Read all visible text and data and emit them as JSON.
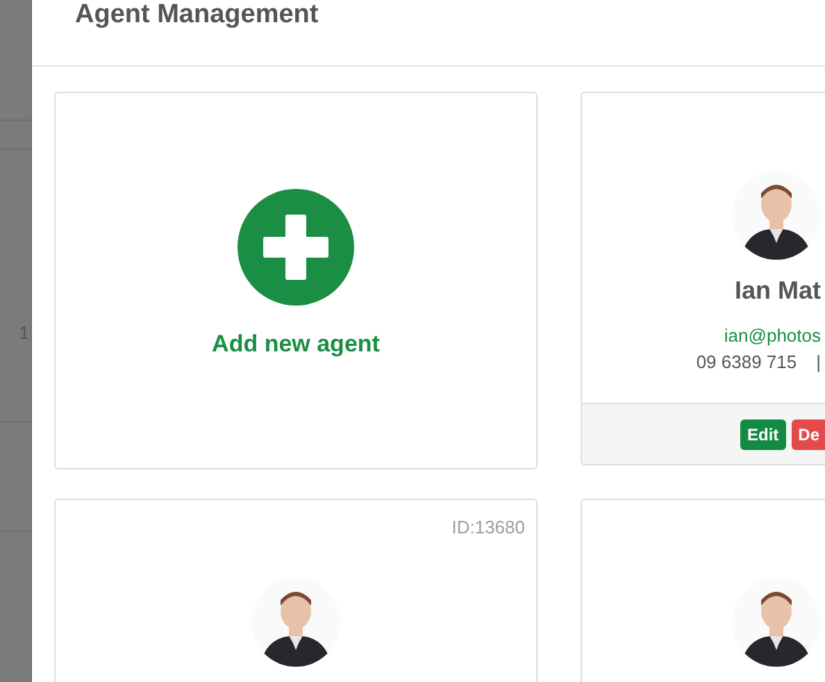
{
  "backdrop": {
    "text": "1"
  },
  "modal": {
    "title": "Agent Management"
  },
  "add_card": {
    "label": "Add new agent"
  },
  "agents": [
    {
      "avatar": {
        "kind": "picture"
      },
      "name": "Ian Mat",
      "email": "ian@photos",
      "phone": "09 6389 715",
      "separator": "|",
      "actions": [
        {
          "label": "Edit",
          "kind": "edit"
        },
        {
          "label": "De",
          "kind": "delete"
        }
      ]
    },
    {
      "id": "ID:13680",
      "avatar": {
        "kind": "picture"
      }
    },
    {
      "avatar": {
        "kind": "picture"
      }
    }
  ]
}
